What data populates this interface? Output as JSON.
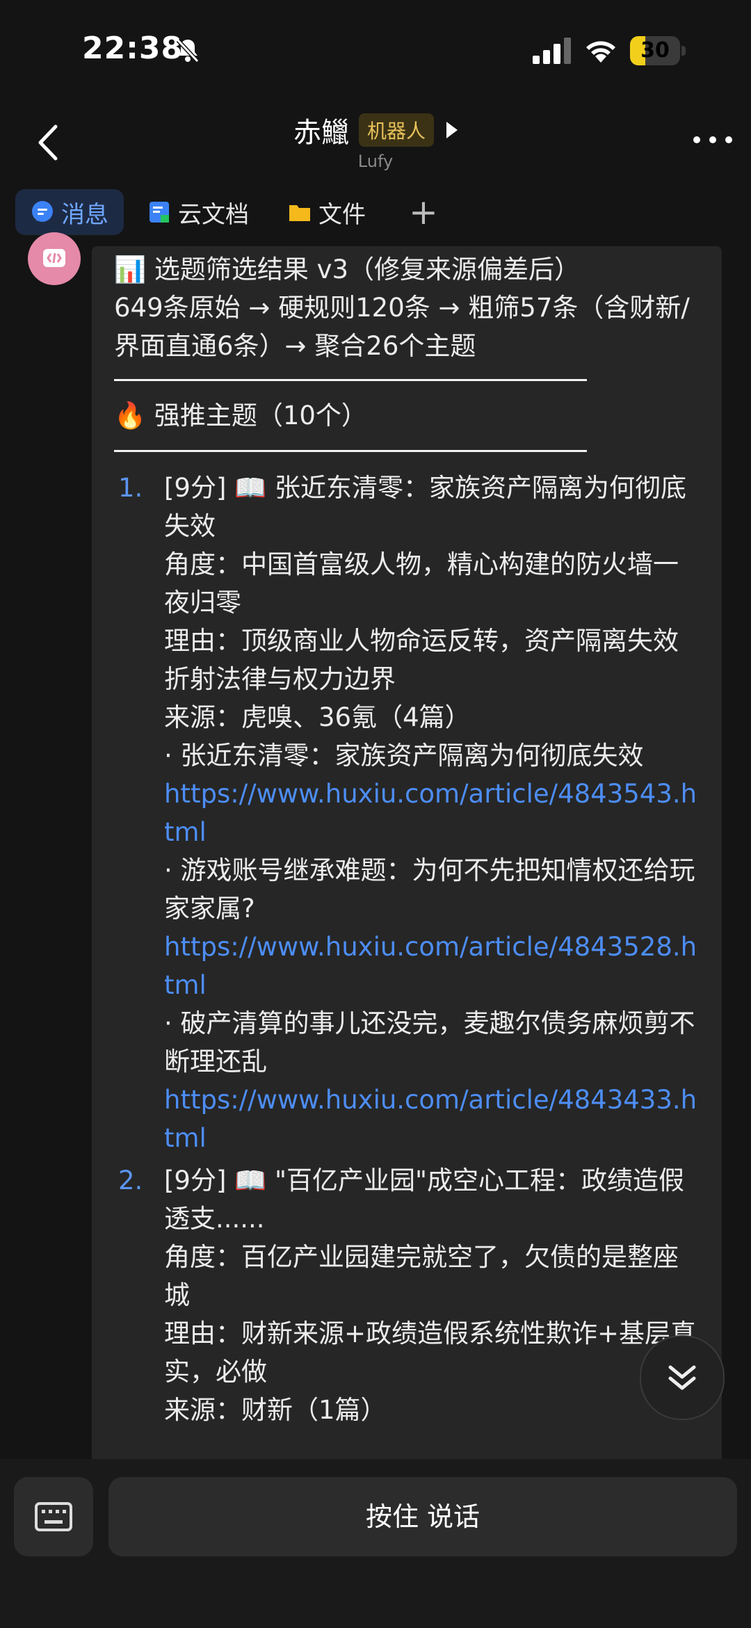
{
  "status": {
    "time": "22:38",
    "battery": "30",
    "battery_level": 0.3
  },
  "header": {
    "title": "赤鱲",
    "badge": "机器人",
    "subtitle": "Lufy"
  },
  "tabs": [
    {
      "label": "消息",
      "icon": "message-icon",
      "active": true
    },
    {
      "label": "云文档",
      "icon": "cloud-doc-icon",
      "active": false
    },
    {
      "label": "文件",
      "icon": "folder-icon",
      "active": false
    }
  ],
  "tab_add": "+",
  "message": {
    "headline1": "📊 选题筛选结果 v3（修复来源偏差后）",
    "headline2": "649条原始 → 硬规则120条 → 粗筛57条（含财新/界面直通6条）→ 聚合26个主题",
    "section": "🔥 强推主题（10个）",
    "items": [
      {
        "num": "1.",
        "title": "[9分] 📖 张近东清零：家族资产隔离为何彻底失效",
        "angle": "角度：中国首富级人物，精心构建的防火墙一夜归零",
        "reason": "理由：顶级商业人物命运反转，资产隔离失效折射法律与权力边界",
        "source": "来源：虎嗅、36氪（4篇）",
        "articles": [
          {
            "title": "· 张近东清零：家族资产隔离为何彻底失效",
            "url": "https://www.huxiu.com/article/4843543.html"
          },
          {
            "title": "· 游戏账号继承难题：为何不先把知情权还给玩家家属?",
            "url": "https://www.huxiu.com/article/4843528.html"
          },
          {
            "title": "· 破产清算的事儿还没完，麦趣尔债务麻烦剪不断理还乱",
            "url": "https://www.huxiu.com/article/4843433.html"
          }
        ]
      },
      {
        "num": "2.",
        "title": "[9分] 📖 \"百亿产业园\"成空心工程：政绩造假透支......",
        "angle": "角度：百亿产业园建完就空了，欠债的是整座城",
        "reason": "理由：财新来源+政绩造假系统性欺诈+基层真实，必做",
        "source": "来源：财新（1篇）"
      }
    ]
  },
  "input": {
    "talk_label": "按住 说话"
  }
}
